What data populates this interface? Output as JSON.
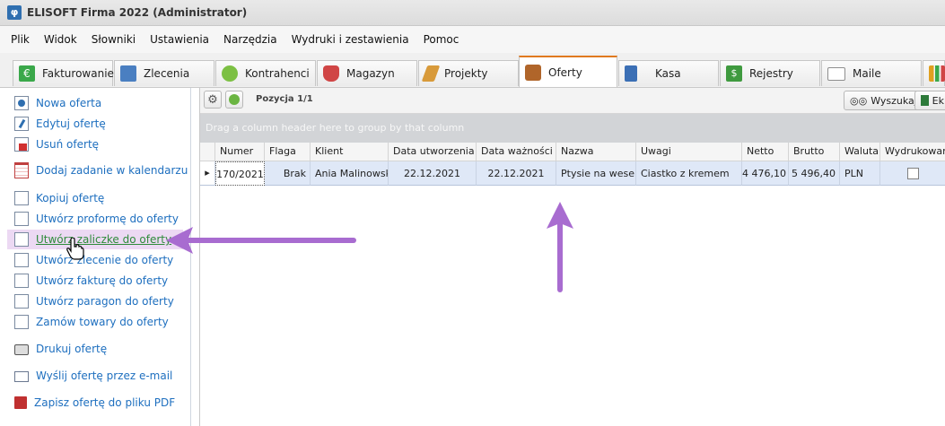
{
  "window": {
    "title": "ELISOFT Firma 2022 (Administrator)",
    "app_icon": "φ"
  },
  "menu": [
    "Plik",
    "Widok",
    "Słowniki",
    "Ustawienia",
    "Narzędzia",
    "Wydruki i zestawienia",
    "Pomoc"
  ],
  "tabs": [
    {
      "label": "Fakturowanie",
      "icon": "currency-euro-icon",
      "color": "#3aa84a"
    },
    {
      "label": "Zlecenia",
      "icon": "documents-icon",
      "color": "#4a7fc1"
    },
    {
      "label": "Kontrahenci",
      "icon": "people-icon",
      "color": "#7cc043"
    },
    {
      "label": "Magazyn",
      "icon": "bags-icon",
      "color": "#d04545"
    },
    {
      "label": "Projekty",
      "icon": "ruler-pencil-icon",
      "color": "#d89a3a"
    },
    {
      "label": "Oferty",
      "icon": "briefcase-icon",
      "color": "#b0652a",
      "active": true
    },
    {
      "label": "Kasa",
      "icon": "cash-register-icon",
      "color": "#3b6fb5"
    },
    {
      "label": "Rejestry",
      "icon": "dollar-book-icon",
      "color": "#3f9a3f"
    },
    {
      "label": "Maile",
      "icon": "envelope-icon",
      "color": "#8e8e8e"
    },
    {
      "label": "",
      "icon": "bar-chart-icon",
      "color": "#e0a020"
    }
  ],
  "sidebar": {
    "actions": [
      {
        "label": "Nowa oferta",
        "icon": "new-document-icon"
      },
      {
        "label": "Edytuj ofertę",
        "icon": "edit-document-icon"
      },
      {
        "label": "Usuń ofertę",
        "icon": "delete-document-icon"
      },
      {
        "label": "Dodaj zadanie w kalendarzu",
        "icon": "calendar-icon"
      },
      {
        "label": "Kopiuj ofertę",
        "icon": "copy-icon"
      },
      {
        "label": "Utwórz proformę do oferty",
        "icon": "copy-icon"
      },
      {
        "label": "Utwórz zaliczke do oferty",
        "icon": "copy-icon",
        "highlighted": true
      },
      {
        "label": "Utwórz zlecenie do oferty",
        "icon": "copy-icon"
      },
      {
        "label": "Utwórz fakturę do oferty",
        "icon": "copy-icon"
      },
      {
        "label": "Utwórz paragon do oferty",
        "icon": "copy-icon"
      },
      {
        "label": "Zamów towary do oferty",
        "icon": "copy-icon"
      },
      {
        "label": "Drukuj ofertę",
        "icon": "printer-icon"
      },
      {
        "label": "Wyślij ofertę przez e-mail",
        "icon": "email-icon"
      },
      {
        "label": "Zapisz ofertę do pliku PDF",
        "icon": "pdf-icon"
      }
    ]
  },
  "toolbar": {
    "position_label": "Pozycja 1/1",
    "search_label": "Wyszukaj",
    "export_label": "Ek"
  },
  "grid": {
    "group_hint": "Drag a column header here to group by that column",
    "columns": [
      "Numer",
      "Flaga",
      "Klient",
      "Data utworzenia",
      "Data ważności",
      "Nazwa",
      "Uwagi",
      "Netto",
      "Brutto",
      "Waluta",
      "Wydrukowana"
    ],
    "rows": [
      {
        "numer": "170/2021",
        "flaga": "Brak",
        "klient": "Ania Malinowska",
        "data_utworzenia": "22.12.2021",
        "data_waznosci": "22.12.2021",
        "nazwa": "Ptysie na wesele",
        "uwagi": "Ciastko z kremem",
        "netto": "4 476,10",
        "brutto": "5 496,40",
        "waluta": "PLN",
        "wydrukowana": false
      }
    ]
  },
  "colors": {
    "accent": "#e07a1f",
    "link": "#1e6fbf",
    "highlight_bg": "#ecd9f3",
    "annotation_arrow": "#a86cd0",
    "selected_row": "#dfe8f7"
  }
}
